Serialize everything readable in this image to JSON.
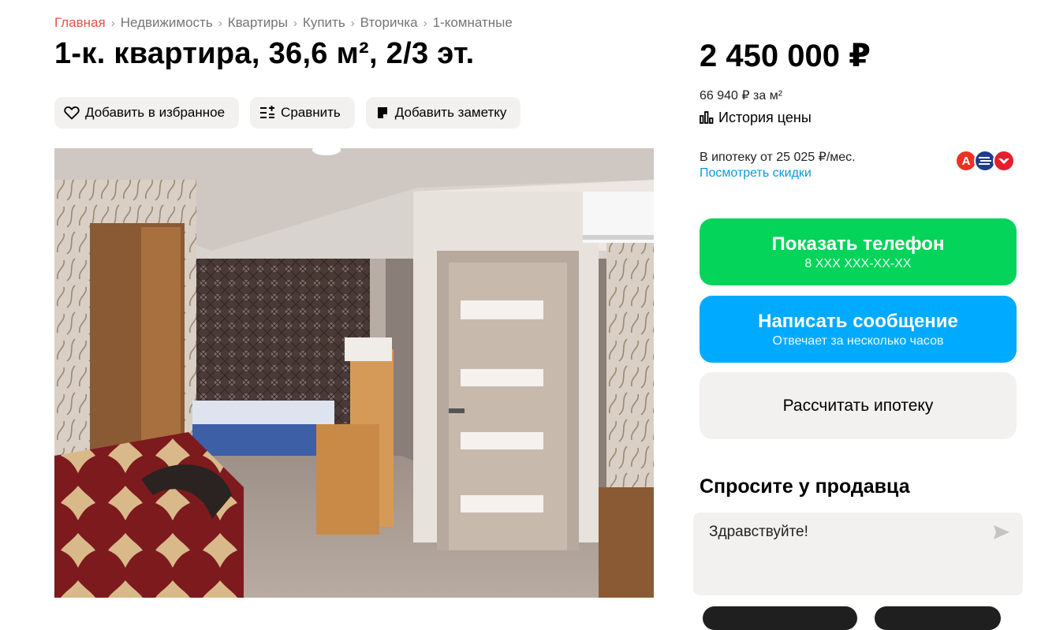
{
  "breadcrumb": {
    "items": [
      "Главная",
      "Недвижимость",
      "Квартиры",
      "Купить",
      "Вторичка",
      "1-комнатные"
    ],
    "separator": "›"
  },
  "listing": {
    "title": "1-к. квартира, 36,6 м², 2/3 эт.",
    "price": "2 450 000 ₽",
    "price_per_m": "66 940 ₽ за м²",
    "price_history_label": "История цены"
  },
  "actions": {
    "favorite_label": "Добавить в избранное",
    "compare_label": "Сравнить",
    "note_label": "Добавить заметку"
  },
  "mortgage": {
    "text": "В ипотеку от 25 025 ₽/мес.",
    "discount_link": "Посмотреть скидки",
    "bank_icons": [
      "alfa-bank-icon",
      "sber-like-bank-icon",
      "red-bank-icon"
    ]
  },
  "contact": {
    "phone_button_label": "Показать телефон",
    "phone_masked": "8 XXX XXX-XX-XX",
    "message_button_label": "Написать сообщение",
    "message_button_sub": "Отвечает за несколько часов",
    "mortgage_button_label": "Рассчитать ипотеку"
  },
  "ask_seller": {
    "title": "Спросите у продавца",
    "message_value": "Здравствуйте!"
  },
  "colors": {
    "accent_green": "#04d45a",
    "accent_blue": "#00aaff",
    "link_blue": "#0a9bdc",
    "breadcrumb_home": "#ec5149",
    "button_gray": "#f2f1f0"
  }
}
